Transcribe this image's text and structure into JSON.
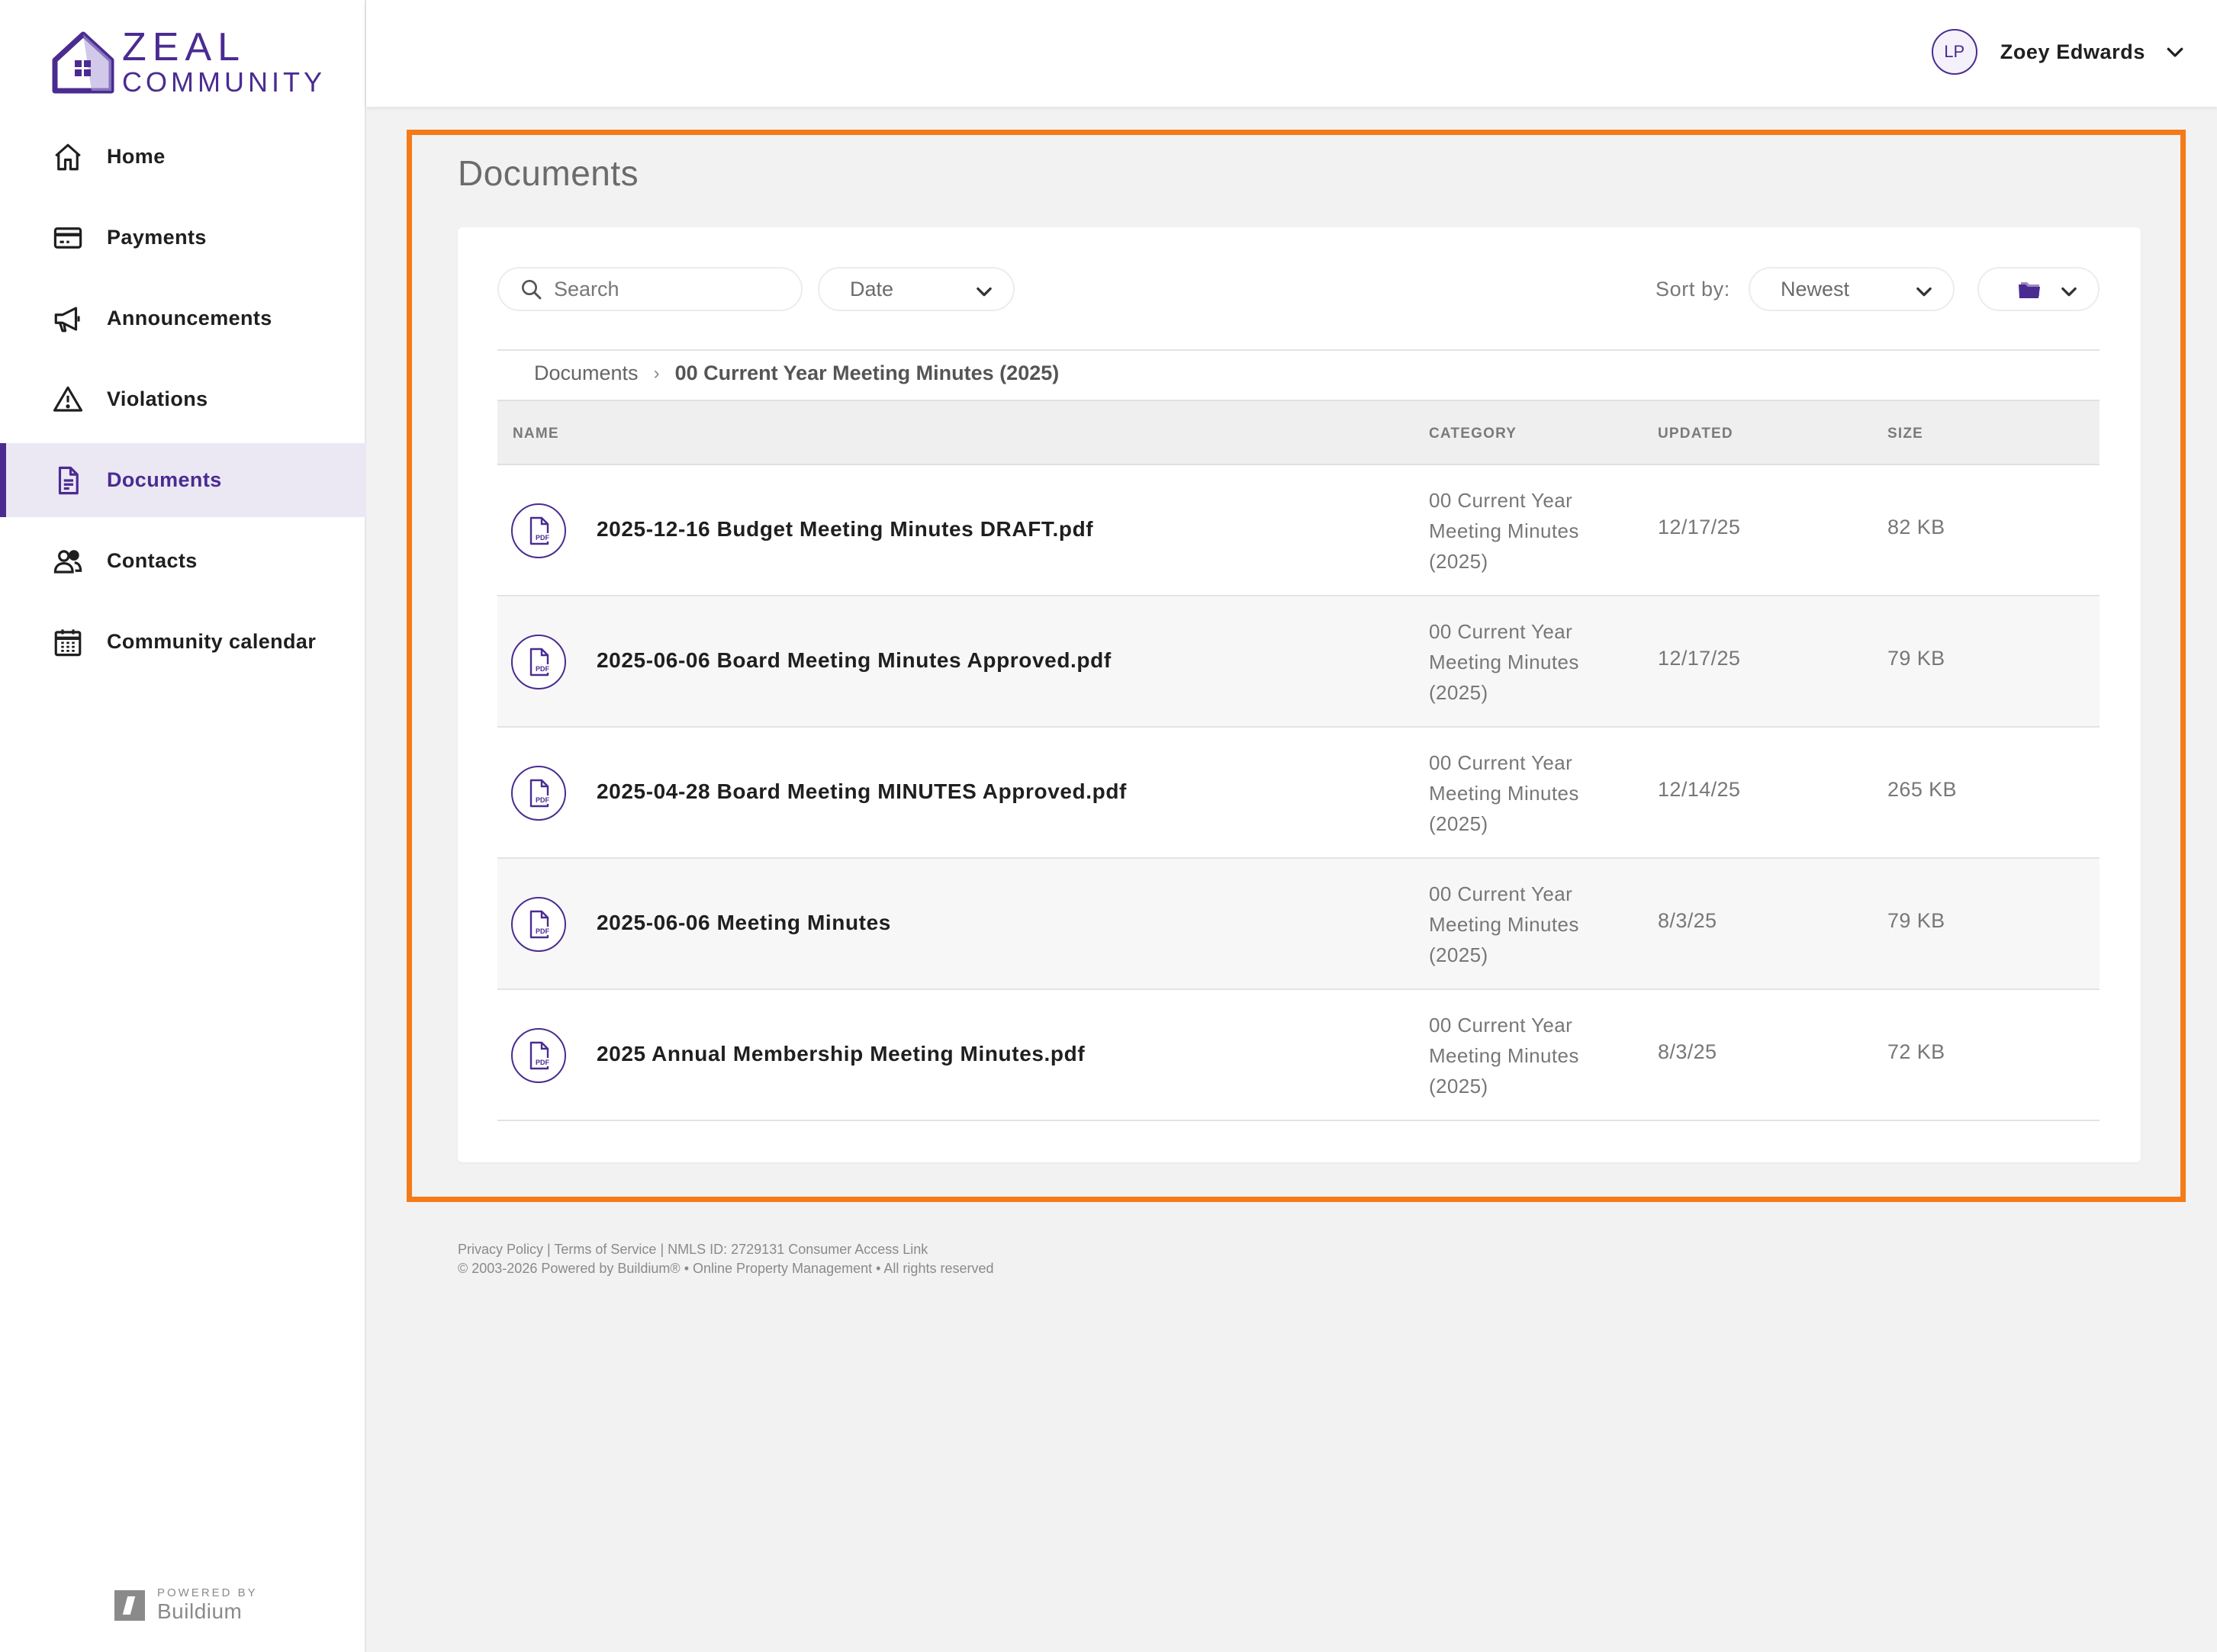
{
  "brand": {
    "line1": "ZEAL",
    "line2": "COMMUNITY",
    "accent_color": "#4a2c91",
    "highlight_color": "#f57b18"
  },
  "sidebar": {
    "items": [
      {
        "label": "Home",
        "icon": "home-icon"
      },
      {
        "label": "Payments",
        "icon": "credit-card-icon"
      },
      {
        "label": "Announcements",
        "icon": "megaphone-icon"
      },
      {
        "label": "Violations",
        "icon": "warning-icon"
      },
      {
        "label": "Documents",
        "icon": "document-icon",
        "active": true
      },
      {
        "label": "Contacts",
        "icon": "contacts-icon"
      },
      {
        "label": "Community calendar",
        "icon": "calendar-icon"
      }
    ],
    "powered_small": "POWERED BY",
    "powered_big": "Buildium"
  },
  "header": {
    "avatar_initials": "LP",
    "user_name": "Zoey Edwards"
  },
  "page": {
    "title": "Documents"
  },
  "toolbar": {
    "search_placeholder": "Search",
    "date_filter": "Date",
    "sort_label": "Sort by:",
    "sort_value": "Newest"
  },
  "breadcrumb": {
    "root": "Documents",
    "separator": "›",
    "current": "00 Current Year Meeting Minutes (2025)"
  },
  "table": {
    "headers": {
      "name": "NAME",
      "category": "CATEGORY",
      "updated": "UPDATED",
      "size": "SIZE"
    },
    "rows": [
      {
        "name": "2025-12-16 Budget Meeting Minutes DRAFT.pdf",
        "category_lines": [
          "00 Current Year",
          "Meeting Minutes",
          "(2025)"
        ],
        "updated": "12/17/25",
        "size": "82 KB"
      },
      {
        "name": "2025-06-06 Board Meeting Minutes Approved.pdf",
        "category_lines": [
          "00 Current Year",
          "Meeting Minutes",
          "(2025)"
        ],
        "updated": "12/17/25",
        "size": "79 KB"
      },
      {
        "name": "2025-04-28 Board Meeting MINUTES Approved.pdf",
        "category_lines": [
          "00 Current Year",
          "Meeting Minutes",
          "(2025)"
        ],
        "updated": "12/14/25",
        "size": "265 KB"
      },
      {
        "name": "2025-06-06 Meeting Minutes",
        "category_lines": [
          "00 Current Year",
          "Meeting Minutes",
          "(2025)"
        ],
        "updated": "8/3/25",
        "size": "79 KB"
      },
      {
        "name": "2025 Annual Membership Meeting Minutes.pdf",
        "category_lines": [
          "00 Current Year",
          "Meeting Minutes",
          "(2025)"
        ],
        "updated": "8/3/25",
        "size": "72 KB"
      }
    ]
  },
  "footer": {
    "privacy": "Privacy Policy",
    "terms": "Terms of Service",
    "nmls": "NMLS ID: 2729131",
    "consumer": "Consumer Access Link",
    "copyright": "© 2003-2026 Powered by Buildium® • Online Property Management • All rights reserved"
  }
}
